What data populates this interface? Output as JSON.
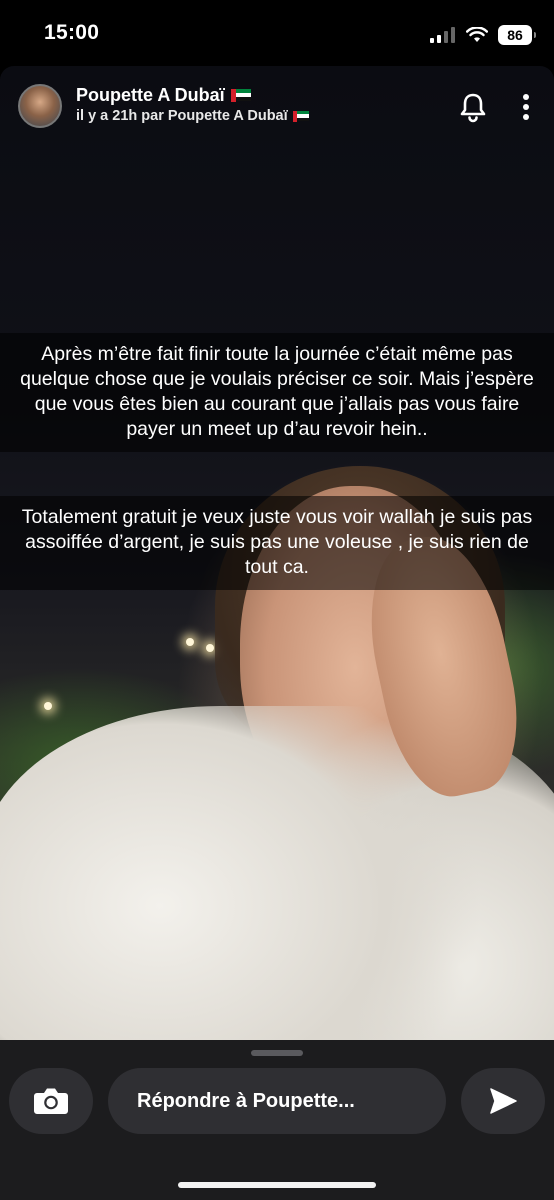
{
  "status_bar": {
    "time": "15:00",
    "battery": "86",
    "icons": [
      "cellular-signal-icon",
      "wifi-icon",
      "battery-icon"
    ]
  },
  "story": {
    "header": {
      "name": "Poupette A Dubaï",
      "subtitle": "il y a 21h par Poupette A Dubaï",
      "flag_icon": "uae-flag-icon",
      "icons": [
        "bell-icon",
        "more-vertical-icon"
      ]
    },
    "captions": [
      "Après m’être fait finir toute la journée c’était même pas quelque chose que je voulais préciser ce soir. Mais j’espère que vous êtes bien au courant que j’allais pas vous faire payer un meet up d’au revoir hein..",
      "Totalement gratuit je veux juste vous voir wallah je suis pas assoiffée d’argent, je suis pas une voleuse , je suis rien de tout ca."
    ]
  },
  "reply_bar": {
    "placeholder": "Répondre à Poupette...",
    "icons": [
      "camera-icon",
      "send-icon"
    ]
  },
  "colors": {
    "bottom_bar": "#1c1c1e",
    "button_bg": "#2f2f33",
    "caption_bg": "rgba(0,0,0,0.55)"
  }
}
